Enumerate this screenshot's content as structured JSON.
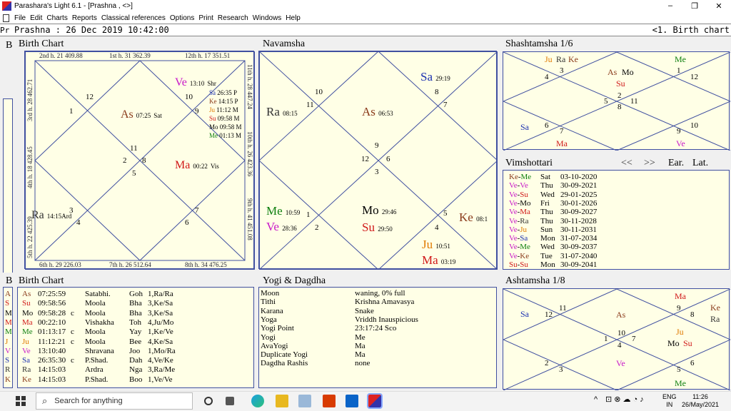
{
  "window": {
    "title": "Parashara's Light 6.1 - [Prashna , <>]",
    "minimize": "–",
    "maximize": "❐",
    "close": "✕"
  },
  "menu": [
    "File",
    "Edit",
    "Charts",
    "Reports",
    "Classical references",
    "Options",
    "Print",
    "Research",
    "Windows",
    "Help"
  ],
  "info": {
    "left_stub": "Pr",
    "left": "Prashna :  26 Dec 2019  10:42:00",
    "right": "<1. Birth chart"
  },
  "stubs": {
    "b1": "B",
    "b2": "B",
    "s1": "S"
  },
  "birth_chart": {
    "title": "Birth Chart",
    "top": [
      "2nd h.  21  409.88",
      "1st h.  31  362.39",
      "12th h.  17  351.51"
    ],
    "bottom": [
      "6th h.  29  226.03",
      "7th h.  26  512.64",
      "8th h.  34  476.25"
    ],
    "left": [
      "3rd h.  28  462.71",
      "4th h.  18  428.45",
      "5th h.  22  425.39"
    ],
    "right": [
      "11th h.  28  447.24",
      "10th h.  26  423.36",
      "9th h.  41  451.08"
    ],
    "numbers": [
      "12",
      "1",
      "11",
      "2",
      "8",
      "5",
      "3",
      "4",
      "7",
      "6",
      "10",
      "9"
    ],
    "planets": {
      "as": {
        "name": "As",
        "deg": "07:25",
        "nak": "Sat"
      },
      "ve": {
        "name": "Ve",
        "deg": "13:10",
        "nak": "Shr"
      },
      "ma": {
        "name": "Ma",
        "deg": "00:22",
        "nak": "Vis"
      },
      "ra": {
        "name": "Ra",
        "deg": "14:15",
        "nak": "Ard"
      },
      "stack": [
        {
          "name": "Sa",
          "deg": "26:35",
          "nak": "P"
        },
        {
          "name": "Ke",
          "deg": "14:15",
          "nak": "P"
        },
        {
          "name": "Ju",
          "deg": "11:12",
          "nak": "M"
        },
        {
          "name": "Su",
          "deg": "09:58",
          "nak": "M"
        },
        {
          "name": "Mo",
          "deg": "09:58",
          "nak": "M"
        },
        {
          "name": "Me",
          "deg": "01:13",
          "nak": "M"
        }
      ]
    }
  },
  "navamsha": {
    "title": "Navamsha",
    "numbers": [
      "10",
      "11",
      "8",
      "7",
      "12",
      "9",
      "6",
      "3",
      "1",
      "2",
      "5",
      "4"
    ],
    "planets": [
      {
        "name": "Sa",
        "deg": "29:19"
      },
      {
        "name": "Ra",
        "deg": "08:15"
      },
      {
        "name": "As",
        "deg": "06:53"
      },
      {
        "name": "Me",
        "deg": "10:59"
      },
      {
        "name": "Ve",
        "deg": "28:36"
      },
      {
        "name": "Mo",
        "deg": "29:46"
      },
      {
        "name": "Su",
        "deg": "29:50"
      },
      {
        "name": "Ke",
        "deg": "08:1"
      },
      {
        "name": "Ju",
        "deg": "10:51"
      },
      {
        "name": "Ma",
        "deg": "03:19"
      }
    ]
  },
  "shashtamsha": {
    "title": "Shashtamsha 1/6",
    "numbers": [
      "3",
      "4",
      "1",
      "12",
      "2",
      "5",
      "11",
      "8",
      "6",
      "7",
      "9",
      "10"
    ],
    "planets": [
      "Ju",
      "Ra",
      "Ke",
      "Me",
      "As",
      "Mo",
      "Su",
      "Sa",
      "Ma",
      "Ve"
    ]
  },
  "vimshottari": {
    "title": "Vimshottari",
    "nav": [
      "<<",
      ">>",
      "Ear.",
      "Lat."
    ],
    "rows": [
      {
        "dasha": "Ke-Me",
        "day": "Sat",
        "date": "03-10-2020"
      },
      {
        "dasha": "Ve-Ve",
        "day": "Thu",
        "date": "30-09-2021"
      },
      {
        "dasha": "Ve-Su",
        "day": "Wed",
        "date": "29-01-2025"
      },
      {
        "dasha": "Ve-Mo",
        "day": "Fri",
        "date": "30-01-2026"
      },
      {
        "dasha": "Ve-Ma",
        "day": "Thu",
        "date": "30-09-2027"
      },
      {
        "dasha": "Ve-Ra",
        "day": "Thu",
        "date": "30-11-2028"
      },
      {
        "dasha": "Ve-Ju",
        "day": "Sun",
        "date": "30-11-2031"
      },
      {
        "dasha": "Ve-Sa",
        "day": "Mon",
        "date": "31-07-2034"
      },
      {
        "dasha": "Ve-Me",
        "day": "Wed",
        "date": "30-09-2037"
      },
      {
        "dasha": "Ve-Ke",
        "day": "Tue",
        "date": "31-07-2040"
      },
      {
        "dasha": "Su-Su",
        "day": "Mon",
        "date": "30-09-2041"
      }
    ]
  },
  "birth_list": {
    "title": "Birth Chart",
    "rows": [
      {
        "p": "As",
        "deg": "07:25:59",
        "r": "",
        "nak": "Satabhi.",
        "pada": "Goh",
        "info": "1,Ra/Ra"
      },
      {
        "p": "Su",
        "deg": "09:58:56",
        "r": "",
        "nak": "Moola",
        "pada": "Bha",
        "info": "3,Ke/Sa"
      },
      {
        "p": "Mo",
        "deg": "09:58:28",
        "r": "c",
        "nak": "Moola",
        "pada": "Bha",
        "info": "3,Ke/Sa"
      },
      {
        "p": "Ma",
        "deg": "00:22:10",
        "r": "",
        "nak": "Vishakha",
        "pada": "Toh",
        "info": "4,Ju/Mo"
      },
      {
        "p": "Me",
        "deg": "01:13:17",
        "r": "c",
        "nak": "Moola",
        "pada": "Yay",
        "info": "1,Ke/Ve"
      },
      {
        "p": "Ju",
        "deg": "11:12:21",
        "r": "c",
        "nak": "Moola",
        "pada": "Bee",
        "info": "4,Ke/Sa"
      },
      {
        "p": "Ve",
        "deg": "13:10:40",
        "r": "",
        "nak": "Shravana",
        "pada": "Joo",
        "info": "1,Mo/Ra"
      },
      {
        "p": "Sa",
        "deg": "26:35:30",
        "r": "c",
        "nak": "P.Shad.",
        "pada": "Dah",
        "info": "4,Ve/Ke"
      },
      {
        "p": "Ra",
        "deg": "14:15:03",
        "r": "",
        "nak": "Ardra",
        "pada": "Nga",
        "info": "3,Ra/Me"
      },
      {
        "p": "Ke",
        "deg": "14:15:03",
        "r": "",
        "nak": "P.Shad.",
        "pada": "Boo",
        "info": "1,Ve/Ve"
      }
    ],
    "stubs": [
      "A",
      "S",
      "M",
      "M",
      "M",
      "J",
      "V",
      "S",
      "R",
      "K"
    ]
  },
  "yogi": {
    "title": "Yogi & Dagdha",
    "rows": [
      {
        "k": "Moon",
        "v": "waning, 0% full"
      },
      {
        "k": "Tithi",
        "v": "Krishna  Amavasya"
      },
      {
        "k": "Karana",
        "v": "Snake"
      },
      {
        "k": "Yoga",
        "v": "Vriddh Inauspicious"
      },
      {
        "k": "Yogi Point",
        "v": "23:17:24 Sco"
      },
      {
        "k": "Yogi",
        "v": "Me"
      },
      {
        "k": "AvaYogi",
        "v": "Ma"
      },
      {
        "k": "Duplicate Yogi",
        "v": "Ma"
      },
      {
        "k": "Dagdha Rashis",
        "v": "none"
      }
    ]
  },
  "ashtamsha": {
    "title": "Ashtamsha 1/8",
    "numbers": [
      "12",
      "11",
      "9",
      "8",
      "10",
      "1",
      "7",
      "4",
      "2",
      "3",
      "5",
      "6"
    ],
    "planets": [
      "Ma",
      "Sa",
      "As",
      "Ke",
      "Ra",
      "Ju",
      "Mo",
      "Su",
      "Ve",
      "Me"
    ]
  },
  "taskbar": {
    "search": "Search for anything",
    "lang1": "ENG",
    "lang2": "IN",
    "time": "11:26",
    "date": "26/May/2021"
  },
  "colors": {
    "red": "#d01818",
    "blue": "#1a2fb0",
    "green": "#108010",
    "magenta": "#c818c8",
    "orange": "#e07a00",
    "brown": "#8a3a1a",
    "border": "#4050a0",
    "chart_bg": "#ffffe6"
  }
}
